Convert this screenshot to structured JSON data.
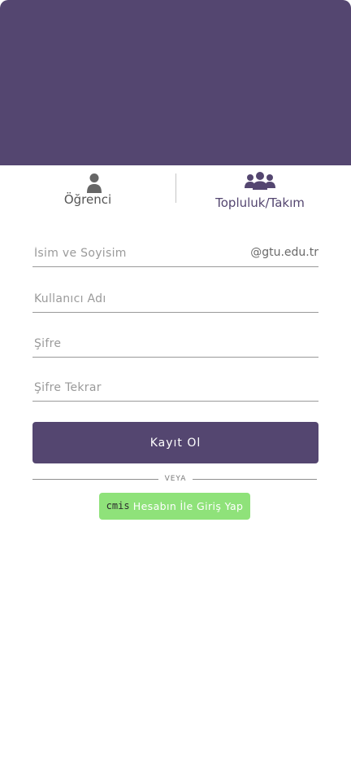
{
  "colors": {
    "brand": "#544670",
    "cmis_green": "#8fe27a",
    "background": "#ffffff"
  },
  "tabs": {
    "student": {
      "label": "Öğrenci",
      "icon": "user-icon"
    },
    "community": {
      "label": "Topluluk/Takım",
      "icon": "users-icon"
    }
  },
  "form": {
    "name_placeholder": "İsim ve Soyisim",
    "email_domain": "@gtu.edu.tr",
    "username_placeholder": "Kullanıcı Adı",
    "password_placeholder": "Şifre",
    "password_repeat_placeholder": "Şifre Tekrar"
  },
  "register_label": "Kayıt Ol",
  "divider_label": "VEYA",
  "cmis": {
    "logo_text": "cmis",
    "login_label": "Hesabın İle Giriş Yap"
  }
}
